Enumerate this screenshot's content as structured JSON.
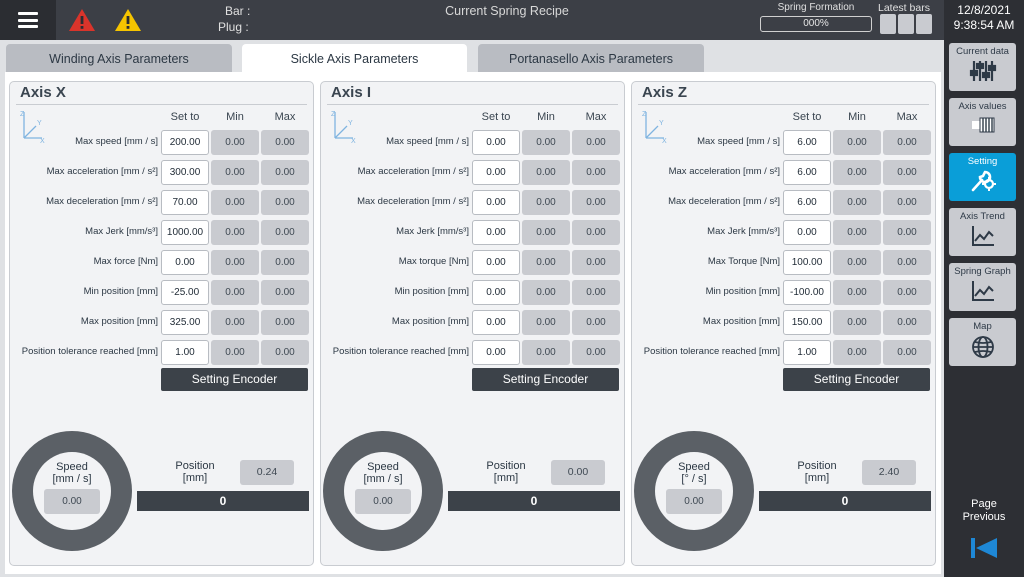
{
  "header": {
    "bar_label": "Bar :",
    "plug_label": "Plug :",
    "title": "Current Spring Recipe",
    "spring_formation_label": "Spring Formation",
    "spring_formation_value": "000%",
    "latest_bars_label": "Latest bars",
    "date": "12/8/2021",
    "time": "9:38:54 AM"
  },
  "tabs": [
    {
      "label": "Winding Axis Parameters",
      "active": false
    },
    {
      "label": "Sickle Axis Parameters",
      "active": true
    },
    {
      "label": "Portanasello Axis Parameters",
      "active": false
    }
  ],
  "column_headers": {
    "set": "Set to",
    "min": "Min",
    "max": "Max"
  },
  "encoder_button": "Setting Encoder",
  "axes": [
    {
      "title": "Axis X",
      "speed_label": "Speed\n[mm / s]",
      "speed_value": "0.00",
      "position_label": "Position\n[mm]",
      "position_value": "0.24",
      "position_bar": "0",
      "rows": [
        {
          "label": "Max speed [mm / s]",
          "set": "200.00",
          "min": "0.00",
          "max": "0.00"
        },
        {
          "label": "Max acceleration [mm / s²]",
          "set": "300.00",
          "min": "0.00",
          "max": "0.00"
        },
        {
          "label": "Max deceleration [mm / s²]",
          "set": "70.00",
          "min": "0.00",
          "max": "0.00"
        },
        {
          "label": "Max Jerk [mm/s³]",
          "set": "1000.00",
          "min": "0.00",
          "max": "0.00"
        },
        {
          "label": "Max force [Nm]",
          "set": "0.00",
          "min": "0.00",
          "max": "0.00"
        },
        {
          "label": "Min position [mm]",
          "set": "-25.00",
          "min": "0.00",
          "max": "0.00"
        },
        {
          "label": "Max position [mm]",
          "set": "325.00",
          "min": "0.00",
          "max": "0.00"
        },
        {
          "label": "Position tolerance reached [mm]",
          "set": "1.00",
          "min": "0.00",
          "max": "0.00"
        }
      ]
    },
    {
      "title": "Axis I",
      "speed_label": "Speed\n[mm / s]",
      "speed_value": "0.00",
      "position_label": "Position\n[mm]",
      "position_value": "0.00",
      "position_bar": "0",
      "rows": [
        {
          "label": "Max speed [mm / s]",
          "set": "0.00",
          "min": "0.00",
          "max": "0.00"
        },
        {
          "label": "Max acceleration [mm / s²]",
          "set": "0.00",
          "min": "0.00",
          "max": "0.00"
        },
        {
          "label": "Max deceleration [mm / s²]",
          "set": "0.00",
          "min": "0.00",
          "max": "0.00"
        },
        {
          "label": "Max Jerk [mm/s³]",
          "set": "0.00",
          "min": "0.00",
          "max": "0.00"
        },
        {
          "label": "Max torque [Nm]",
          "set": "0.00",
          "min": "0.00",
          "max": "0.00"
        },
        {
          "label": "Min position [mm]",
          "set": "0.00",
          "min": "0.00",
          "max": "0.00"
        },
        {
          "label": "Max position [mm]",
          "set": "0.00",
          "min": "0.00",
          "max": "0.00"
        },
        {
          "label": "Position tolerance reached [mm]",
          "set": "0.00",
          "min": "0.00",
          "max": "0.00"
        }
      ]
    },
    {
      "title": "Axis Z",
      "speed_label": "Speed\n[° / s]",
      "speed_value": "0.00",
      "position_label": "Position\n[mm]",
      "position_value": "2.40",
      "position_bar": "0",
      "rows": [
        {
          "label": "Max speed [mm / s]",
          "set": "6.00",
          "min": "0.00",
          "max": "0.00"
        },
        {
          "label": "Max acceleration [mm / s²]",
          "set": "6.00",
          "min": "0.00",
          "max": "0.00"
        },
        {
          "label": "Max deceleration [mm / s²]",
          "set": "6.00",
          "min": "0.00",
          "max": "0.00"
        },
        {
          "label": "Max Jerk [mm/s³]",
          "set": "0.00",
          "min": "0.00",
          "max": "0.00"
        },
        {
          "label": "Max Torque [Nm]",
          "set": "100.00",
          "min": "0.00",
          "max": "0.00"
        },
        {
          "label": "Min position [mm]",
          "set": "-100.00",
          "min": "0.00",
          "max": "0.00"
        },
        {
          "label": "Max position [mm]",
          "set": "150.00",
          "min": "0.00",
          "max": "0.00"
        },
        {
          "label": "Position tolerance reached [mm]",
          "set": "1.00",
          "min": "0.00",
          "max": "0.00"
        }
      ]
    }
  ],
  "sidebar": {
    "items": [
      {
        "label": "Current data",
        "icon": "sliders-icon"
      },
      {
        "label": "Axis values",
        "icon": "axis-values-icon"
      },
      {
        "label": "Setting",
        "icon": "wrench-gear-icon",
        "active": true
      },
      {
        "label": "Axis Trend",
        "icon": "trend-chart-icon"
      },
      {
        "label": "Spring Graph",
        "icon": "graph-chart-icon"
      },
      {
        "label": "Map",
        "icon": "globe-icon"
      }
    ],
    "page_previous": "Page\nPrevious"
  },
  "colors": {
    "active_blue": "#0a9ed8",
    "warning_red": "#d9342b",
    "warning_yellow": "#f5c400"
  }
}
